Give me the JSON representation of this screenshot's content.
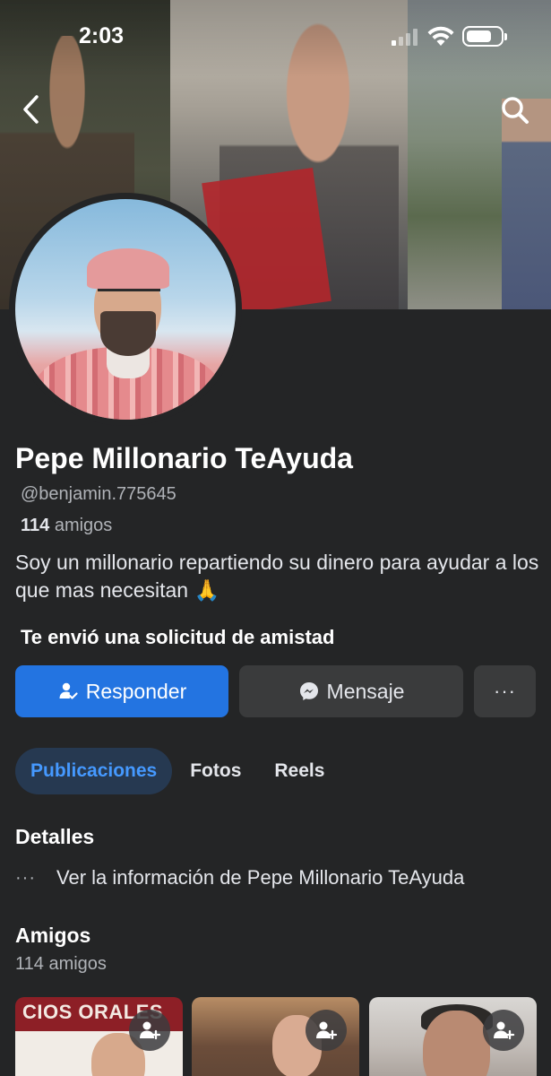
{
  "status_bar": {
    "time": "2:03"
  },
  "profile": {
    "name": "Pepe Millonario TeAyuda",
    "username": "@benjamin.775645",
    "friends_count": "114",
    "friends_word": "amigos",
    "bio": "Soy un millonario repartiendo su dinero para ayudar a los que mas necesitan 🙏"
  },
  "request": {
    "text": "Te envió una solicitud de amistad"
  },
  "actions": {
    "respond_label": "Responder",
    "message_label": "Mensaje",
    "more_label": "···"
  },
  "tabs": [
    {
      "label": "Publicaciones",
      "active": true
    },
    {
      "label": "Fotos",
      "active": false
    },
    {
      "label": "Reels",
      "active": false
    }
  ],
  "details": {
    "title": "Detalles",
    "info_text": "Ver la información de Pepe Millonario TeAyuda",
    "dots": "···"
  },
  "friends_section": {
    "title": "Amigos",
    "count_text": "114 amigos",
    "cards": [
      {
        "banner_text": "CIOS ORALES"
      },
      {},
      {}
    ]
  },
  "colors": {
    "background": "#242526",
    "primary_button": "#2374e1",
    "secondary_button": "#3a3b3c",
    "active_tab_bg": "#263951",
    "active_tab_text": "#4599ff"
  },
  "icons": {
    "back": "chevron-left-icon",
    "search": "search-icon",
    "respond": "person-check-icon",
    "message": "messenger-icon",
    "add_friend": "add-person-icon"
  }
}
